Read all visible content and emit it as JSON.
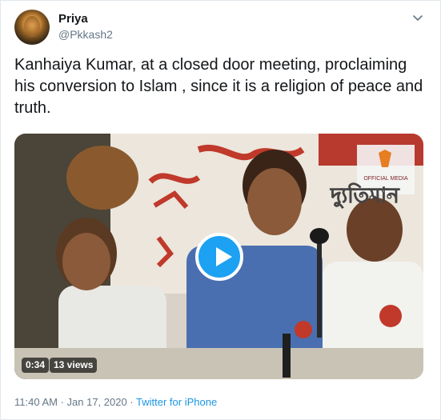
{
  "tweet": {
    "display_name": "Priya",
    "handle": "@Pkkash2",
    "text": "Kanhaiya Kumar, at a closed door meeting, proclaiming his conversion to Islam , since it is a religion of peace and truth.",
    "timestamp": "11:40 AM · Jan 17, 2020 · ",
    "source": "Twitter for iPhone"
  },
  "video": {
    "duration": "0:34",
    "views": "13 views",
    "watermark_text": "দ্যুতিমান",
    "overlay_label": "OFFICIAL MEDIA",
    "accent_color": "#1da1f2"
  },
  "colors": {
    "text_primary": "#14171a",
    "text_secondary": "#657786",
    "link": "#1b95e0",
    "border": "#e1e8ed"
  }
}
